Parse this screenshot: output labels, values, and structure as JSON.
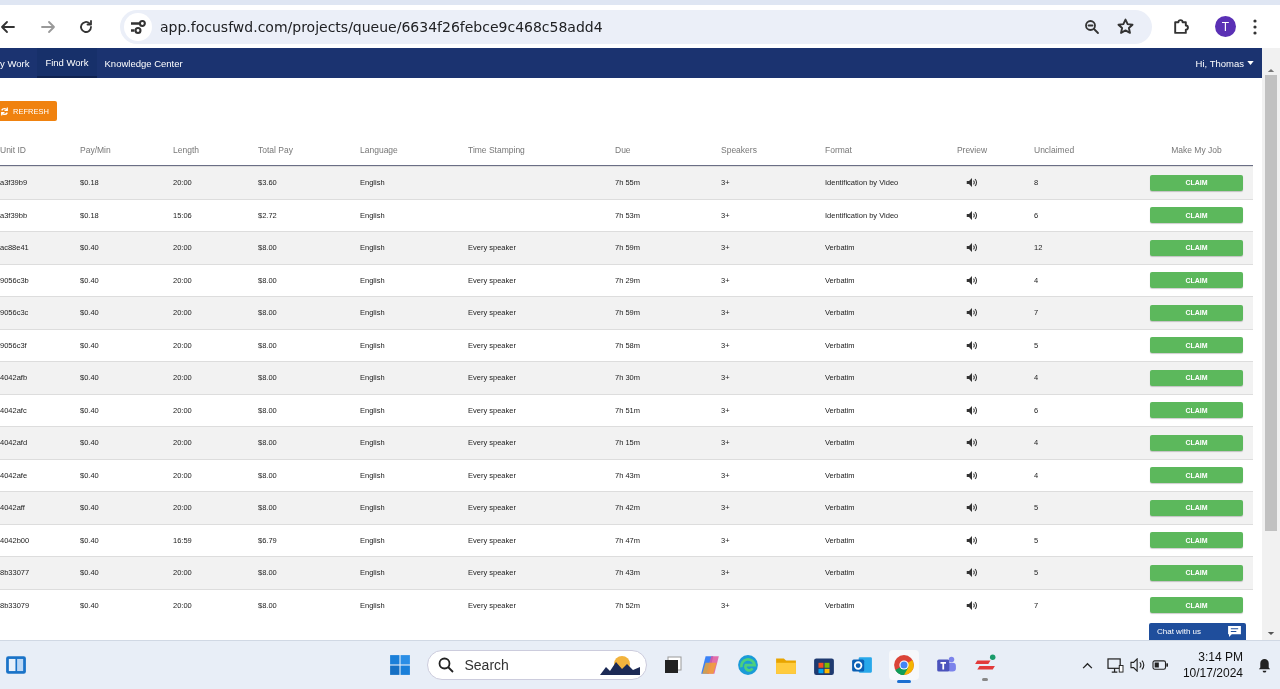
{
  "browser": {
    "url": "app.focusfwd.com/projects/queue/6634f26febce9c468c58add4",
    "avatar": "T"
  },
  "nav": {
    "items": [
      {
        "label": "y Work",
        "selected": false
      },
      {
        "label": "Find Work",
        "selected": true
      },
      {
        "label": "Knowledge Center",
        "selected": false
      }
    ],
    "user": "Hi, Thomas"
  },
  "refresh_button": "REFRESH",
  "table": {
    "columns": [
      "Unit ID",
      "Pay/Min",
      "Length",
      "Total Pay",
      "Language",
      "Time Stamping",
      "Due",
      "Speakers",
      "Format",
      "Preview",
      "Unclaimed",
      "Make My Job"
    ],
    "rows": [
      {
        "id": "a3f39b9",
        "pay_min": "$0.18",
        "length": "20:00",
        "total_pay": "$3.60",
        "language": "English",
        "due": "7h 55m",
        "speakers": "3+",
        "format": "Identification by Video",
        "unclaimed": "8",
        "action": "CLAIM"
      },
      {
        "id": "a3f39bb",
        "pay_min": "$0.18",
        "length": "15:06",
        "total_pay": "$2.72",
        "language": "English",
        "due": "7h 53m",
        "speakers": "3+",
        "format": "Identification by Video",
        "unclaimed": "6",
        "action": "CLAIM"
      },
      {
        "id": "ac88e41",
        "pay_min": "$0.40",
        "length": "20:00",
        "total_pay": "$8.00",
        "language": "English",
        "time_stamping": "Every speaker",
        "due": "7h 59m",
        "speakers": "3+",
        "format": "Verbatim",
        "unclaimed": "12",
        "action": "CLAIM"
      },
      {
        "id": "9056c3b",
        "pay_min": "$0.40",
        "length": "20:00",
        "total_pay": "$8.00",
        "language": "English",
        "time_stamping": "Every speaker",
        "due": "7h 29m",
        "speakers": "3+",
        "format": "Verbatim",
        "unclaimed": "4",
        "action": "CLAIM"
      },
      {
        "id": "9056c3c",
        "pay_min": "$0.40",
        "length": "20:00",
        "total_pay": "$8.00",
        "language": "English",
        "time_stamping": "Every speaker",
        "due": "7h 59m",
        "speakers": "3+",
        "format": "Verbatim",
        "unclaimed": "7",
        "action": "CLAIM"
      },
      {
        "id": "9056c3f",
        "pay_min": "$0.40",
        "length": "20:00",
        "total_pay": "$8.00",
        "language": "English",
        "time_stamping": "Every speaker",
        "due": "7h 58m",
        "speakers": "3+",
        "format": "Verbatim",
        "unclaimed": "5",
        "action": "CLAIM"
      },
      {
        "id": "4042afb",
        "pay_min": "$0.40",
        "length": "20:00",
        "total_pay": "$8.00",
        "language": "English",
        "time_stamping": "Every speaker",
        "due": "7h 30m",
        "speakers": "3+",
        "format": "Verbatim",
        "unclaimed": "4",
        "action": "CLAIM"
      },
      {
        "id": "4042afc",
        "pay_min": "$0.40",
        "length": "20:00",
        "total_pay": "$8.00",
        "language": "English",
        "time_stamping": "Every speaker",
        "due": "7h 51m",
        "speakers": "3+",
        "format": "Verbatim",
        "unclaimed": "6",
        "action": "CLAIM"
      },
      {
        "id": "4042afd",
        "pay_min": "$0.40",
        "length": "20:00",
        "total_pay": "$8.00",
        "language": "English",
        "time_stamping": "Every speaker",
        "due": "7h 15m",
        "speakers": "3+",
        "format": "Verbatim",
        "unclaimed": "4",
        "action": "CLAIM"
      },
      {
        "id": "4042afe",
        "pay_min": "$0.40",
        "length": "20:00",
        "total_pay": "$8.00",
        "language": "English",
        "time_stamping": "Every speaker",
        "due": "7h 43m",
        "speakers": "3+",
        "format": "Verbatim",
        "unclaimed": "4",
        "action": "CLAIM"
      },
      {
        "id": "4042aff",
        "pay_min": "$0.40",
        "length": "20:00",
        "total_pay": "$8.00",
        "language": "English",
        "time_stamping": "Every speaker",
        "due": "7h 42m",
        "speakers": "3+",
        "format": "Verbatim",
        "unclaimed": "5",
        "action": "CLAIM"
      },
      {
        "id": "4042b00",
        "pay_min": "$0.40",
        "length": "16:59",
        "total_pay": "$6.79",
        "language": "English",
        "time_stamping": "Every speaker",
        "due": "7h 47m",
        "speakers": "3+",
        "format": "Verbatim",
        "unclaimed": "5",
        "action": "CLAIM"
      },
      {
        "id": "8b33077",
        "pay_min": "$0.40",
        "length": "20:00",
        "total_pay": "$8.00",
        "language": "English",
        "time_stamping": "Every speaker",
        "due": "7h 43m",
        "speakers": "3+",
        "format": "Verbatim",
        "unclaimed": "5",
        "action": "CLAIM"
      },
      {
        "id": "8b33079",
        "pay_min": "$0.40",
        "length": "20:00",
        "total_pay": "$8.00",
        "language": "English",
        "time_stamping": "Every speaker",
        "due": "7h 52m",
        "speakers": "3+",
        "format": "Verbatim",
        "unclaimed": "7",
        "action": "CLAIM"
      }
    ]
  },
  "chat": {
    "label": "Chat with us"
  },
  "taskbar": {
    "search_placeholder": "Search",
    "time": "3:14 PM",
    "date": "10/17/2024",
    "apps": [
      {
        "kind": "start",
        "active": false,
        "running": false
      },
      {
        "kind": "search",
        "active": false,
        "running": false
      },
      {
        "kind": "taskview",
        "active": false,
        "running": false
      },
      {
        "kind": "copilot",
        "active": false,
        "running": false
      },
      {
        "kind": "edge",
        "active": false,
        "running": false
      },
      {
        "kind": "folder",
        "active": false,
        "running": false
      },
      {
        "kind": "store",
        "active": false,
        "running": false
      },
      {
        "kind": "outlook",
        "active": false,
        "running": false
      },
      {
        "kind": "chrome",
        "active": true,
        "running": true
      },
      {
        "kind": "teams",
        "active": false,
        "running": false
      },
      {
        "kind": "red",
        "active": false,
        "running": true
      }
    ]
  }
}
